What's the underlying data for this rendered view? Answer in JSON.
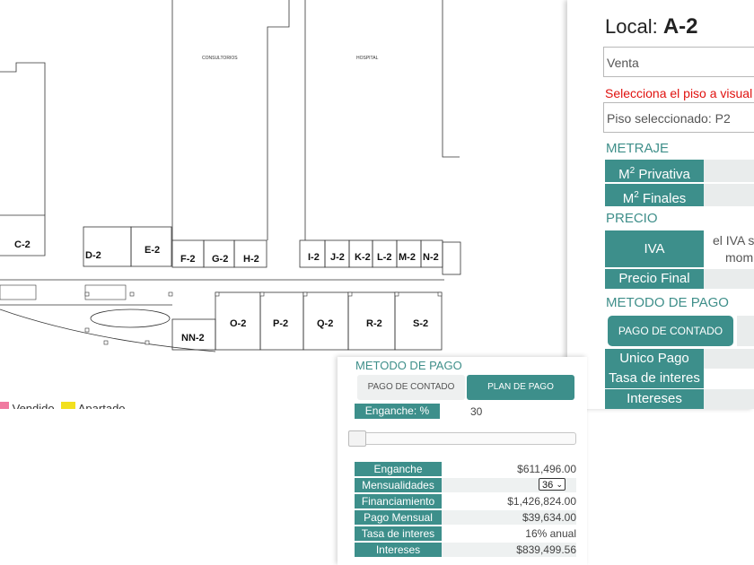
{
  "floor_plan": {
    "buildings": [
      "CONSULTORIOS",
      "HOSPITAL"
    ],
    "units": [
      "C-2",
      "D-2",
      "E-2",
      "F-2",
      "G-2",
      "H-2",
      "I-2",
      "J-2",
      "K-2",
      "L-2",
      "M-2",
      "N-2",
      "NN-2",
      "O-2",
      "P-2",
      "Q-2",
      "R-2",
      "S-2"
    ]
  },
  "legend": {
    "items": [
      {
        "label": "Vendido",
        "color": "#f07aa0"
      },
      {
        "label": "Apartado",
        "color": "#f2e01e"
      }
    ]
  },
  "detail_panel": {
    "local_label": "Local:",
    "local_value": "A-2",
    "operation": "Venta",
    "floor_prompt": "Selecciona el piso a visual",
    "floor_selected": "Piso seleccionado: P2",
    "metraje": {
      "title": "METRAJE",
      "private_label": "M",
      "private_sup": "2",
      "private_suffix": " Privativa",
      "final_label": "M",
      "final_sup": "2",
      "final_suffix": " Finales"
    },
    "precio": {
      "title": "PRECIO",
      "iva_label": "IVA",
      "iva_note_line1": "el IVA s",
      "iva_note_line2": "mom",
      "final_label": "Precio Final"
    },
    "metodo": {
      "title": "METODO DE PAGO",
      "button": "PAGO DE CONTADO",
      "unico_pago": "Unico Pago",
      "tasa": "Tasa de interes",
      "intereses": "Intereses"
    }
  },
  "plan_panel": {
    "title": "METODO DE PAGO",
    "tab_cash": "PAGO DE CONTADO",
    "tab_plan": "PLAN DE PAGO",
    "down_payment_label": "Enganche: %",
    "down_payment_value": "30",
    "slider_fraction": 0.0,
    "rows": [
      {
        "label": "Enganche",
        "value": "$611,496.00"
      },
      {
        "label": "Mensualidades",
        "value": "36"
      },
      {
        "label": "Financiamiento",
        "value": "$1,426,824.00"
      },
      {
        "label": "Pago Mensual",
        "value": "$39,634.00"
      },
      {
        "label": "Tasa de interes",
        "value": "16% anual"
      },
      {
        "label": "Intereses",
        "value": "$839,499.56"
      }
    ]
  },
  "colors": {
    "accent": "#3d8f8b",
    "warning": "#e0120f"
  }
}
